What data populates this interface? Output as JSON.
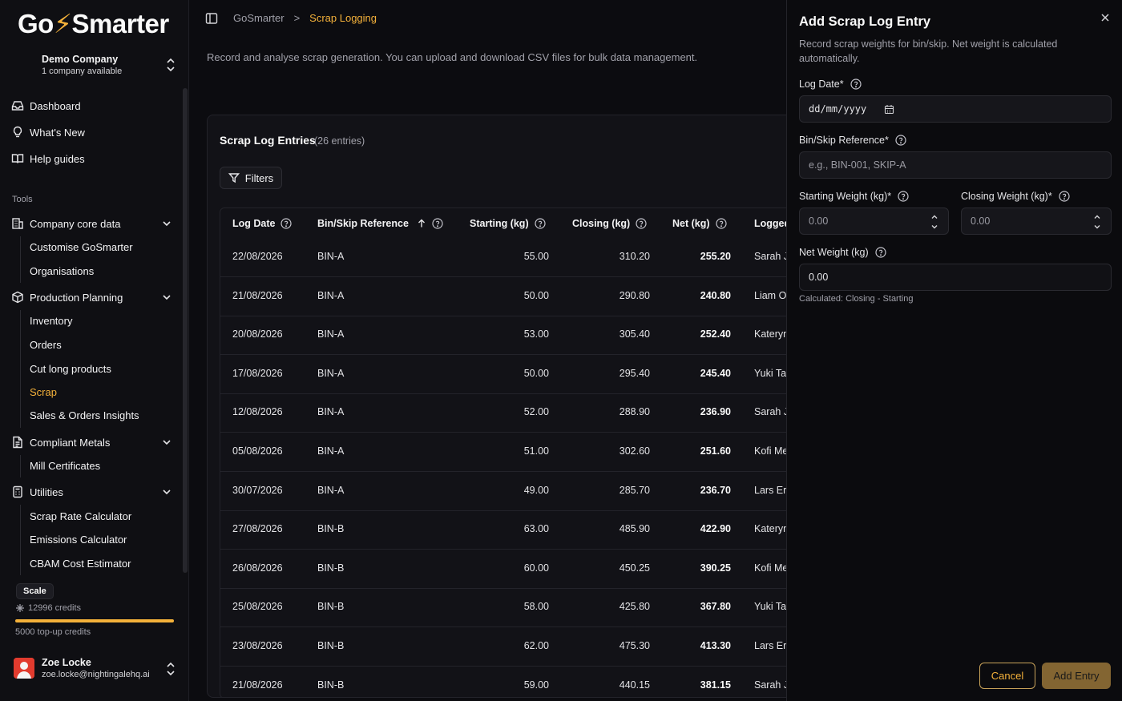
{
  "brand": {
    "logo_prefix": "Go",
    "logo_suffix": "Smarter",
    "accent": "#f4b13a"
  },
  "company": {
    "name": "Demo Company",
    "subtitle": "1 company available"
  },
  "nav": {
    "top": [
      {
        "label": "Dashboard",
        "icon": "inbox-icon"
      },
      {
        "label": "What's New",
        "icon": "lightbulb-icon"
      },
      {
        "label": "Help guides",
        "icon": "book-open-icon"
      }
    ],
    "section_label": "Tools",
    "groups": [
      {
        "label": "Company core data",
        "icon": "building-icon",
        "items": [
          "Customise GoSmarter",
          "Organisations"
        ]
      },
      {
        "label": "Production Planning",
        "icon": "package-icon",
        "items": [
          "Inventory",
          "Orders",
          "Cut long products",
          "Scrap",
          "Sales & Orders Insights"
        ]
      },
      {
        "label": "Compliant Metals",
        "icon": "file-text-icon",
        "items": [
          "Mill Certificates"
        ]
      },
      {
        "label": "Utilities",
        "icon": "calculator-icon",
        "items": [
          "Scrap Rate Calculator",
          "Emissions Calculator",
          "CBAM Cost Estimator"
        ]
      }
    ],
    "active_item": "Scrap"
  },
  "plan": {
    "badge": "Scale",
    "credits": "12996 credits",
    "topup": "5000 top-up credits"
  },
  "user": {
    "name": "Zoe Locke",
    "email": "zoe.locke@nightingalehq.ai"
  },
  "breadcrumb": {
    "root": "GoSmarter",
    "separator": ">",
    "current": "Scrap Logging"
  },
  "page": {
    "description": "Record and analyse scrap generation. You can upload and download CSV files for bulk data management."
  },
  "table_card": {
    "title": "Scrap Log Entries",
    "count": "(26 entries)",
    "filters_label": "Filters",
    "columns": [
      "Log Date",
      "Bin/Skip Reference",
      "Starting (kg)",
      "Closing (kg)",
      "Net (kg)",
      "Logged"
    ],
    "rows": [
      [
        "22/08/2026",
        "BIN-A",
        "55.00",
        "310.20",
        "255.20",
        "Sarah J"
      ],
      [
        "21/08/2026",
        "BIN-A",
        "50.00",
        "290.80",
        "240.80",
        "Liam O"
      ],
      [
        "20/08/2026",
        "BIN-A",
        "53.00",
        "305.40",
        "252.40",
        "Kateryn"
      ],
      [
        "17/08/2026",
        "BIN-A",
        "50.00",
        "295.40",
        "245.40",
        "Yuki Ta"
      ],
      [
        "12/08/2026",
        "BIN-A",
        "52.00",
        "288.90",
        "236.90",
        "Sarah J"
      ],
      [
        "05/08/2026",
        "BIN-A",
        "51.00",
        "302.60",
        "251.60",
        "Kofi Me"
      ],
      [
        "30/07/2026",
        "BIN-A",
        "49.00",
        "285.70",
        "236.70",
        "Lars Er"
      ],
      [
        "27/08/2026",
        "BIN-B",
        "63.00",
        "485.90",
        "422.90",
        "Kateryn"
      ],
      [
        "26/08/2026",
        "BIN-B",
        "60.00",
        "450.25",
        "390.25",
        "Kofi Me"
      ],
      [
        "25/08/2026",
        "BIN-B",
        "58.00",
        "425.80",
        "367.80",
        "Yuki Ta"
      ],
      [
        "23/08/2026",
        "BIN-B",
        "62.00",
        "475.30",
        "413.30",
        "Lars Er"
      ],
      [
        "21/08/2026",
        "BIN-B",
        "59.00",
        "440.15",
        "381.15",
        "Sarah J"
      ]
    ]
  },
  "panel": {
    "title": "Add Scrap Log Entry",
    "description": "Record scrap weights for bin/skip. Net weight is calculated automatically.",
    "log_date": {
      "label": "Log Date*",
      "placeholder": "dd/mm/yyyy"
    },
    "bin_ref": {
      "label": "Bin/Skip Reference*",
      "placeholder": "e.g., BIN-001, SKIP-A"
    },
    "starting": {
      "label": "Starting Weight (kg)*",
      "value": "0.00"
    },
    "closing": {
      "label": "Closing Weight (kg)*",
      "value": "0.00"
    },
    "net": {
      "label": "Net Weight (kg)",
      "value": "0.00",
      "hint": "Calculated: Closing - Starting"
    },
    "cancel_label": "Cancel",
    "add_label": "Add Entry"
  }
}
